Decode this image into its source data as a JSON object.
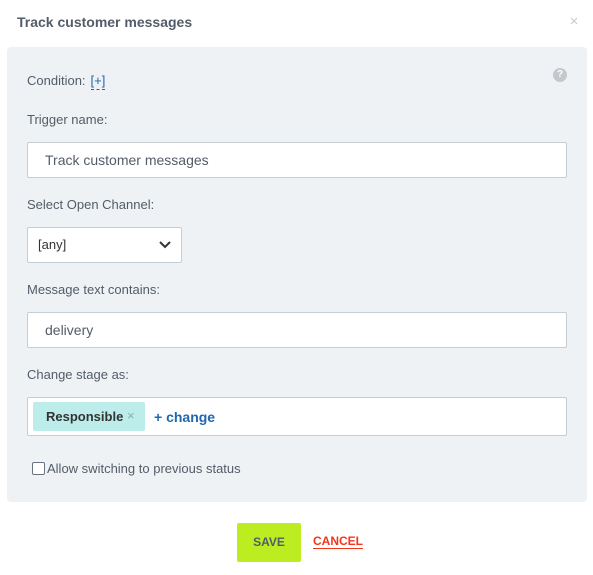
{
  "dialog": {
    "title": "Track customer messages",
    "close_glyph": "×"
  },
  "condition": {
    "label": "Condition:",
    "link": "[+]",
    "help_glyph": "?"
  },
  "trigger_name": {
    "label": "Trigger name:",
    "value": "Track customer messages"
  },
  "open_channel": {
    "label": "Select Open Channel:",
    "selected": "[any]"
  },
  "message_text": {
    "label": "Message text contains:",
    "value": "delivery"
  },
  "change_stage": {
    "label": "Change stage as:",
    "tag": "Responsible",
    "tag_remove_glyph": "×",
    "change_link": "+ change"
  },
  "allow_previous": {
    "label": "Allow switching to previous status",
    "checked": false
  },
  "footer": {
    "save_label": "SAVE",
    "cancel_label": "CANCEL"
  },
  "colors": {
    "accent_link": "#2067b0",
    "save_button": "#bbed21",
    "cancel": "#f0371b",
    "tag_bg": "#bcedeb",
    "panel_bg": "#eef2f4"
  },
  "icons": {
    "close": "close-icon",
    "help": "help-icon",
    "dropdown": "chevron-down-icon",
    "tag_remove": "remove-tag-icon"
  }
}
